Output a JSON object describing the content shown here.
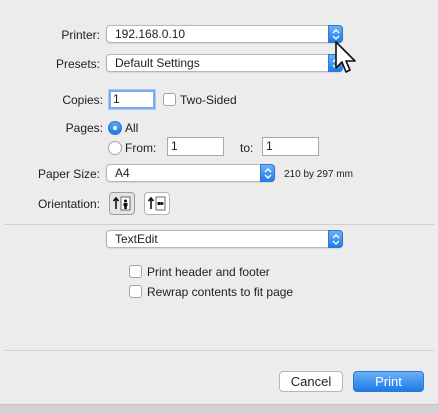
{
  "printer": {
    "label": "Printer:",
    "value": "192.168.0.10"
  },
  "presets": {
    "label": "Presets:",
    "value": "Default Settings"
  },
  "copies": {
    "label": "Copies:",
    "value": "1",
    "two_sided_label": "Two-Sided"
  },
  "pages": {
    "label": "Pages:",
    "all_label": "All",
    "from_label": "From:",
    "from_value": "1",
    "to_label": "to:",
    "to_value": "1"
  },
  "paper_size": {
    "label": "Paper Size:",
    "value": "A4",
    "dimensions": "210 by 297 mm"
  },
  "orientation": {
    "label": "Orientation:",
    "selected": "portrait"
  },
  "app_section": {
    "value": "TextEdit"
  },
  "options": {
    "print_header_footer": "Print header and footer",
    "rewrap_contents": "Rewrap contents to fit page"
  },
  "buttons": {
    "cancel": "Cancel",
    "print": "Print"
  },
  "colors": {
    "accent": "#1f7de8",
    "background": "#ececec"
  }
}
